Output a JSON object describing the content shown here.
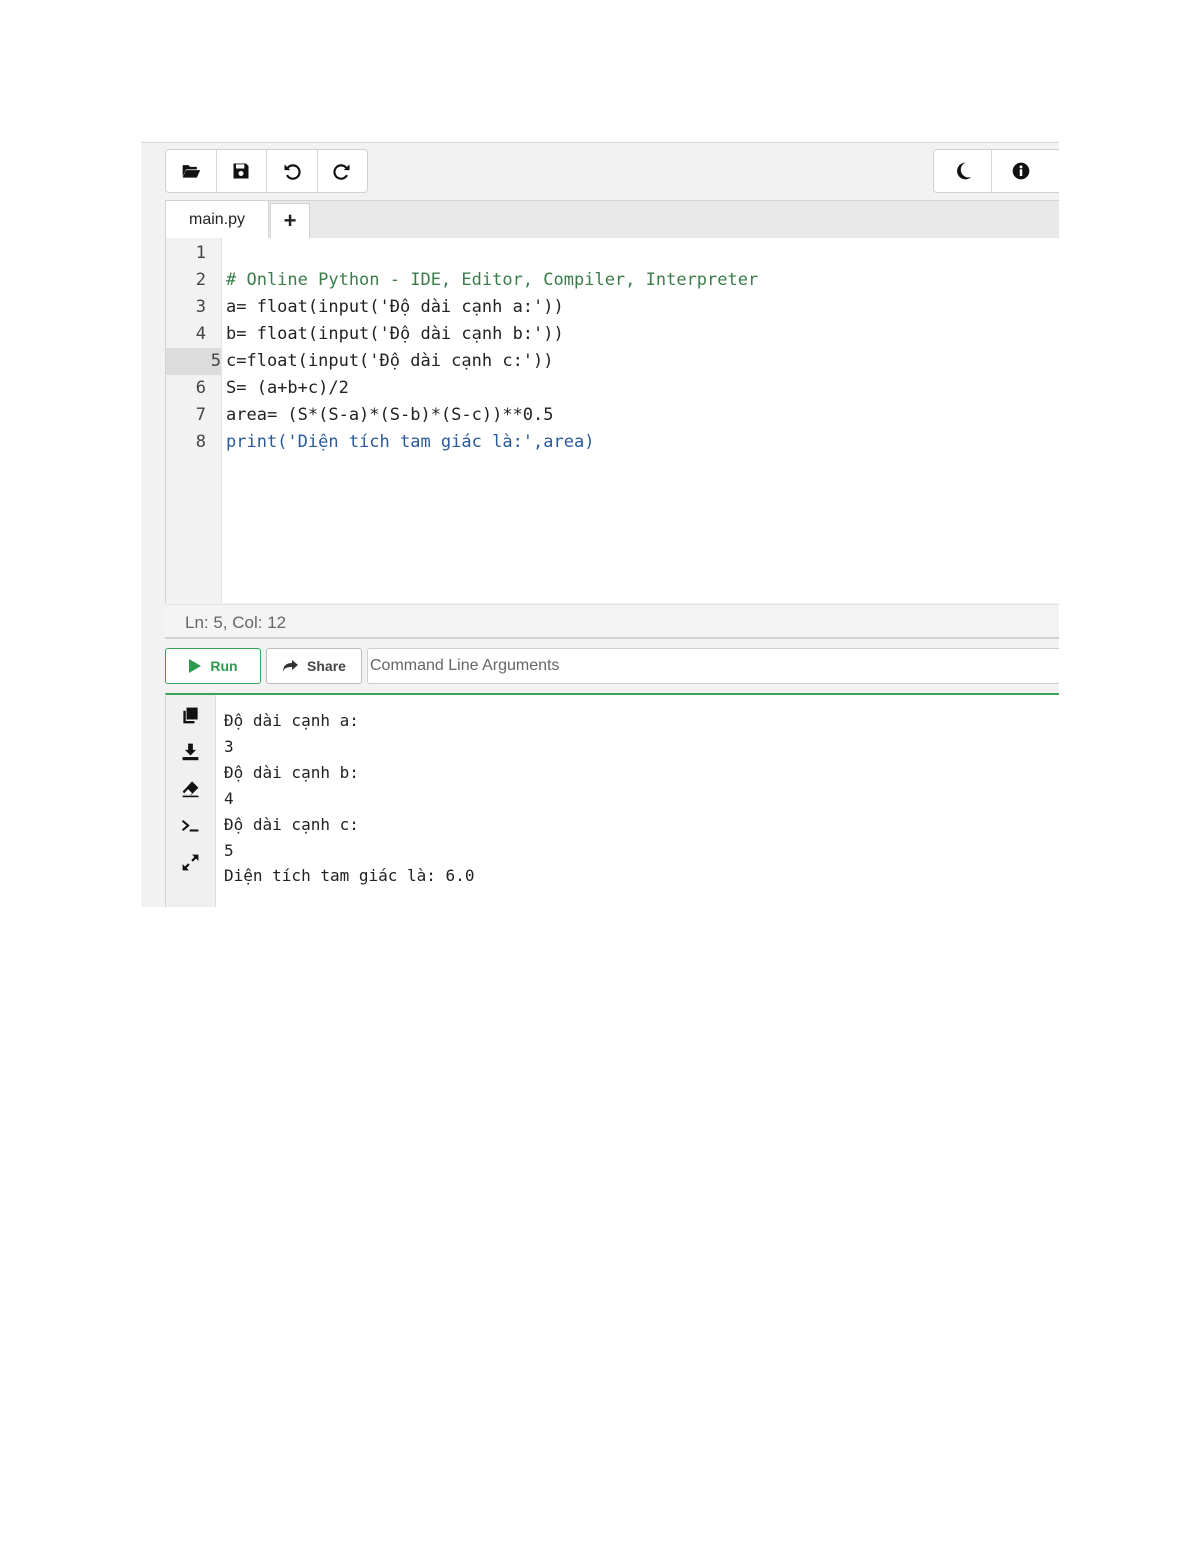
{
  "toolbar": {
    "left_icons": [
      "folder-open-icon",
      "save-icon",
      "undo-icon",
      "redo-icon"
    ],
    "right_icons": [
      "moon-icon",
      "info-icon"
    ]
  },
  "tabs": {
    "file_name": "main.py",
    "add_label": "+"
  },
  "editor": {
    "line_numbers": [
      "1",
      "2",
      "3",
      "4",
      "5",
      "6",
      "7",
      "8"
    ],
    "active_line": "5",
    "lines": [
      "",
      "# Online Python - IDE, Editor, Compiler, Interpreter",
      "a= float(input('Độ dài cạnh a:'))",
      "b= float(input('Độ dài cạnh b:'))",
      "c=float(input('Độ dài cạnh c:'))",
      "S= (a+b+c)/2",
      "area= (S*(S-a)*(S-b)*(S-c))**0.5",
      "print('Diện tích tam giác là:',area)"
    ]
  },
  "status": {
    "cursor": "Ln: 5,  Col: 12"
  },
  "actions": {
    "run_label": "Run",
    "share_label": "Share",
    "args_placeholder": "Command Line Arguments"
  },
  "console": {
    "side_icons": [
      "copy-icon",
      "download-icon",
      "eraser-icon",
      "terminal-icon",
      "expand-icon"
    ],
    "output": [
      "Độ dài cạnh a:",
      "3",
      "Độ dài cạnh b:",
      "4",
      "Độ dài cạnh c:",
      "5",
      "Diện tích tam giác là: 6.0"
    ]
  },
  "colors": {
    "accent_green": "#3aa55a",
    "comment_green": "#3a7d4a"
  }
}
